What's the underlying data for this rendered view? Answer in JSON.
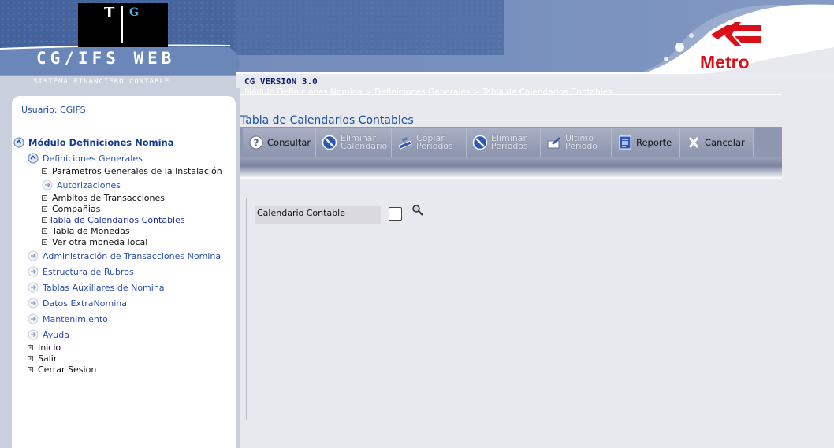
{
  "header": {
    "logo_t": "T",
    "logo_g": "G",
    "app_name": "CG/IFS WEB",
    "app_subtitle": "SISTEMA FINANCIERO CONTABLE",
    "version": "CG VERSION 3.0",
    "breadcrumb": "Módulo Definiciones Nomina > Definiciones Generales > Tabla de Calendarios Contables",
    "brand": "Metro"
  },
  "sidebar": {
    "user": "Usuario: CGIFS",
    "module": "Módulo Definiciones Nomina",
    "groups": [
      "Definiciones Generales",
      "Administración de Transacciones Nomina",
      "Estructura de Rubros",
      "Tablas Auxiliares de Nomina",
      "Datos ExtraNomina",
      "Mantenimiento",
      "Ayuda"
    ],
    "subitems": [
      "Parámetros Generales de la Instalación",
      "Autorizaciones",
      "Ambitos de Transacciones",
      "Compañias",
      "Tabla de Calendarios Contables",
      "Tabla de Monedas",
      "Ver otra moneda local"
    ],
    "bottom": [
      "Inicio",
      "Salir",
      "Cerrar Sesion"
    ]
  },
  "main": {
    "title": "Tabla de Calendarios Contables",
    "toolbar": {
      "consultar": "Consultar",
      "eliminar_cal_1": "Eliminar",
      "eliminar_cal_2": "Calendario",
      "copiar_1": "Copiar",
      "copiar_2": "Periodos",
      "eliminar_per_1": "Eliminar",
      "eliminar_per_2": "Periodos",
      "ultimo_1": "Ultimo",
      "ultimo_2": "Periodo",
      "reporte": "Reporte",
      "cancelar": "Cancelar"
    },
    "field_label": "Calendario Contable"
  },
  "colors": {
    "header_blue": "#3b5890",
    "link_blue": "#2a4fa8",
    "brand_red": "#d8101a",
    "toolbar": "#8e97af"
  }
}
